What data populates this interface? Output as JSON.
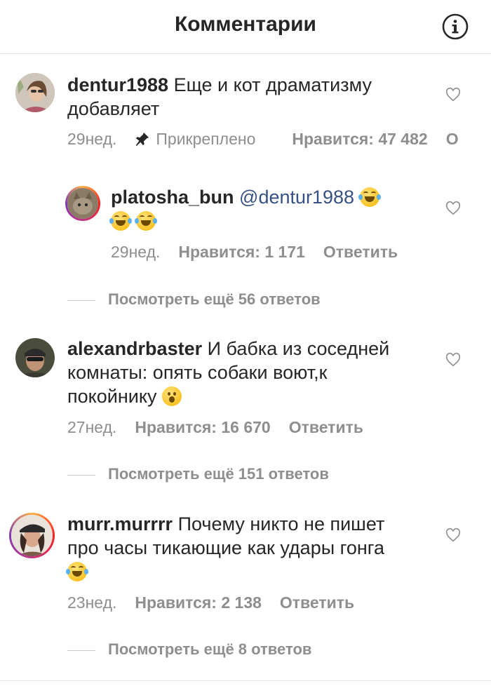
{
  "header": {
    "title": "Комментарии"
  },
  "comments": [
    {
      "username": "dentur1988",
      "text_line1": " Еще и кот драматизму",
      "text_line2": "добавляет",
      "time": "29нед.",
      "pinned": "Прикреплено",
      "likes": "Нравится: 47 482",
      "reply": "Ответить",
      "reply_clipped": "О"
    },
    {
      "username": "platosha_bun",
      "mention": "@dentur1988",
      "time": "29нед.",
      "likes": "Нравится: 1 171",
      "reply": "Ответить"
    },
    {
      "username": "alexandrbaster",
      "text_line1": " И бабка из соседней",
      "text_line2": "комнаты: опять собаки воют,к",
      "text_line3": "покойнику",
      "time": "27нед.",
      "likes": "Нравится: 16 670",
      "reply": "Ответить"
    },
    {
      "username": "murr.murrrr",
      "text_line1": " Почему никто не пишет",
      "text_line2": "про часы тикающие как удары гонга",
      "time": "23нед.",
      "likes": "Нравится: 2 138",
      "reply": "Ответить"
    }
  ],
  "view_more": [
    "Посмотреть ещё 56 ответов",
    "Посмотреть ещё 151 ответов",
    "Посмотреть ещё 8 ответов"
  ],
  "icons": {
    "info": "info-icon",
    "heart": "heart-icon",
    "pin": "pin-icon",
    "emoji_joy": "face-with-tears-of-joy",
    "emoji_wow": "face-with-open-mouth"
  }
}
